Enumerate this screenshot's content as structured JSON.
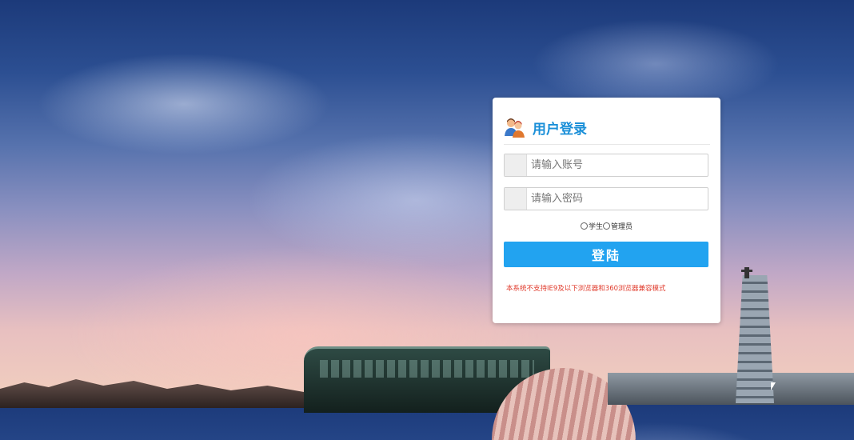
{
  "login": {
    "title": "用户登录",
    "account_placeholder": "请输入账号",
    "password_placeholder": "请输入密码",
    "role_options": [
      {
        "label": "学生"
      },
      {
        "label": "管理员"
      }
    ],
    "submit_label": "登陆",
    "notice": "本系统不支持IE9及以下浏览器和360浏览器兼容模式"
  },
  "colors": {
    "accent": "#22a3f0",
    "title": "#1a8fd8",
    "notice": "#e03a2b"
  },
  "icons": {
    "header": "users-icon"
  }
}
